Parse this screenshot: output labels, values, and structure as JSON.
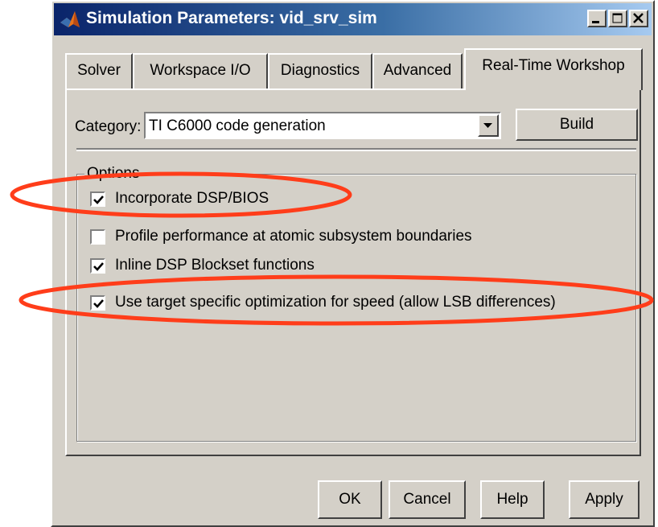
{
  "window": {
    "title": "Simulation Parameters: vid_srv_sim"
  },
  "tabs": [
    {
      "label": "Solver",
      "active": false
    },
    {
      "label": "Workspace I/O",
      "active": false
    },
    {
      "label": "Diagnostics",
      "active": false
    },
    {
      "label": "Advanced",
      "active": false
    },
    {
      "label": "Real-Time Workshop",
      "active": true
    }
  ],
  "category": {
    "label": "Category:",
    "value": "TI C6000 code generation",
    "build_label": "Build"
  },
  "options": {
    "group_title": "Options",
    "items": [
      {
        "label": "Incorporate DSP/BIOS",
        "checked": true
      },
      {
        "label": "Profile performance at atomic subsystem boundaries",
        "checked": false
      },
      {
        "label": "Inline DSP Blockset functions",
        "checked": true
      },
      {
        "label": "Use target specific optimization for speed (allow LSB differences)",
        "checked": true
      }
    ]
  },
  "buttons": {
    "ok": "OK",
    "cancel": "Cancel",
    "help": "Help",
    "apply": "Apply"
  },
  "colors": {
    "annotation_ellipse": "#ff3d1a",
    "titlebar_start": "#0a246a",
    "dialog_face": "#d4d0c8"
  },
  "icons": {
    "app": "matlab-logo-icon",
    "minimize": "minimize-icon",
    "maximize": "maximize-icon",
    "close": "close-icon",
    "dropdown": "chevron-down-icon",
    "check": "checkmark-icon"
  }
}
